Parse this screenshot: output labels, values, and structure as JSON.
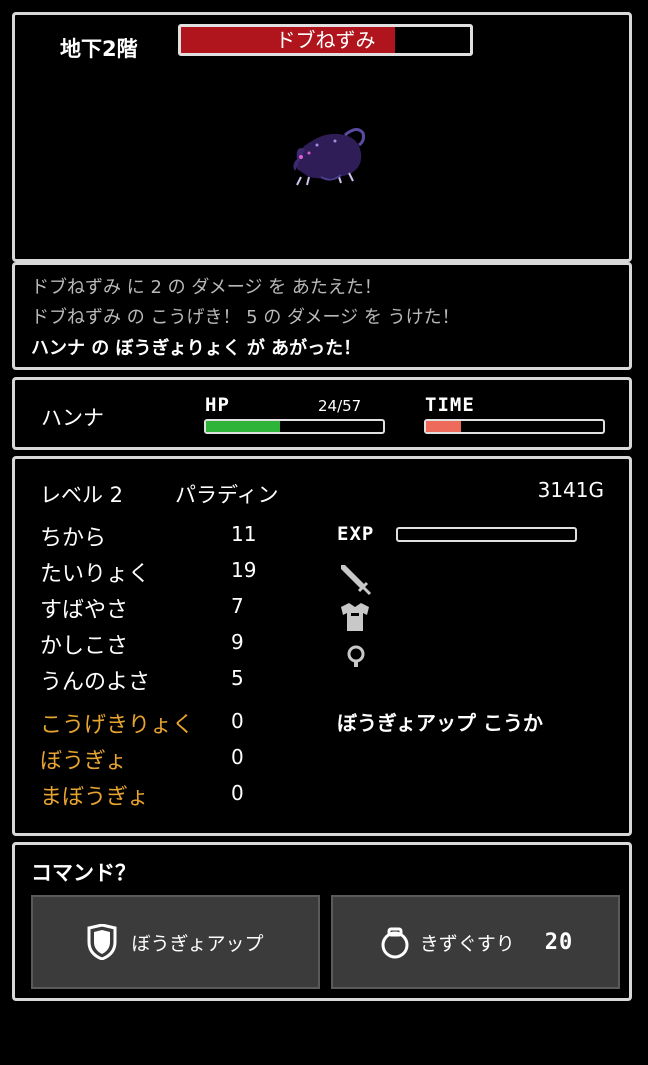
{
  "floor": "地下2階",
  "enemy": {
    "name": "ドブねずみ",
    "hp_fraction": 0.74,
    "hp_color": "#b0151d"
  },
  "messages": [
    "ドブねずみ に 2 の ダメージ を あたえた！",
    "ドブねずみ の こうげき！ 5 の ダメージ を うけた！",
    "ハンナ の ぼうぎょりょく が あがった！"
  ],
  "player": {
    "name": "ハンナ",
    "hp_label": "HP",
    "hp_text": "24/57",
    "hp_fraction": 0.42,
    "hp_color": "#2fb43a",
    "time_label": "TIME",
    "time_fraction": 0.2,
    "time_color": "#ee6a5a"
  },
  "stats": {
    "level": "レベル 2",
    "job": "パラディン",
    "gold": "3141G",
    "exp_label": "EXP",
    "exp_fraction": 0.0,
    "base": [
      {
        "label": "ちから",
        "value": "11"
      },
      {
        "label": "たいりょく",
        "value": "19"
      },
      {
        "label": "すばやさ",
        "value": "7"
      },
      {
        "label": "かしこさ",
        "value": "9"
      },
      {
        "label": "うんのよさ",
        "value": "5"
      }
    ],
    "bonus": [
      {
        "label": "こうげきりょく",
        "value": "0"
      },
      {
        "label": "ぼうぎょ",
        "value": "0"
      },
      {
        "label": "まぼうぎょ",
        "value": "0"
      }
    ],
    "equipment_icons": [
      "sword-icon",
      "armor-icon",
      "accessory-icon"
    ],
    "effect": "ぼうぎょアップ こうか"
  },
  "command": {
    "prompt": "コマンド？",
    "defend_label": "ぼうぎょアップ",
    "defend_icon": "shield-icon",
    "potion_label": "きずぐすり",
    "potion_count": "20",
    "potion_icon": "potion-icon"
  }
}
